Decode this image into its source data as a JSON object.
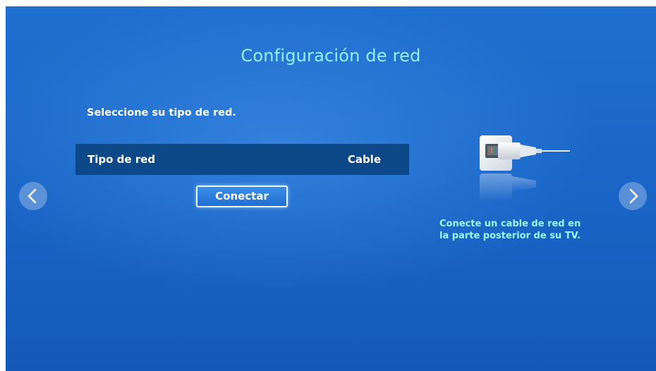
{
  "screen": {
    "title": "Configuración de red",
    "subtitle": "Seleccione su tipo de red."
  },
  "network_type": {
    "label": "Tipo de red",
    "value": "Cable"
  },
  "connect_button": {
    "label": "Conectar"
  },
  "hint": {
    "line1": "Conecte un cable de red en",
    "line2": "la parte posterior de su TV."
  },
  "navigation": {
    "prev_icon": "chevron-left-icon",
    "next_icon": "chevron-right-icon"
  },
  "illustration": {
    "icon": "network-cable-icon"
  },
  "colors": {
    "background": "#1a66c8",
    "title": "#8ff3ff",
    "row_background": "#0d4889",
    "hint_text": "#9ef4ff"
  }
}
